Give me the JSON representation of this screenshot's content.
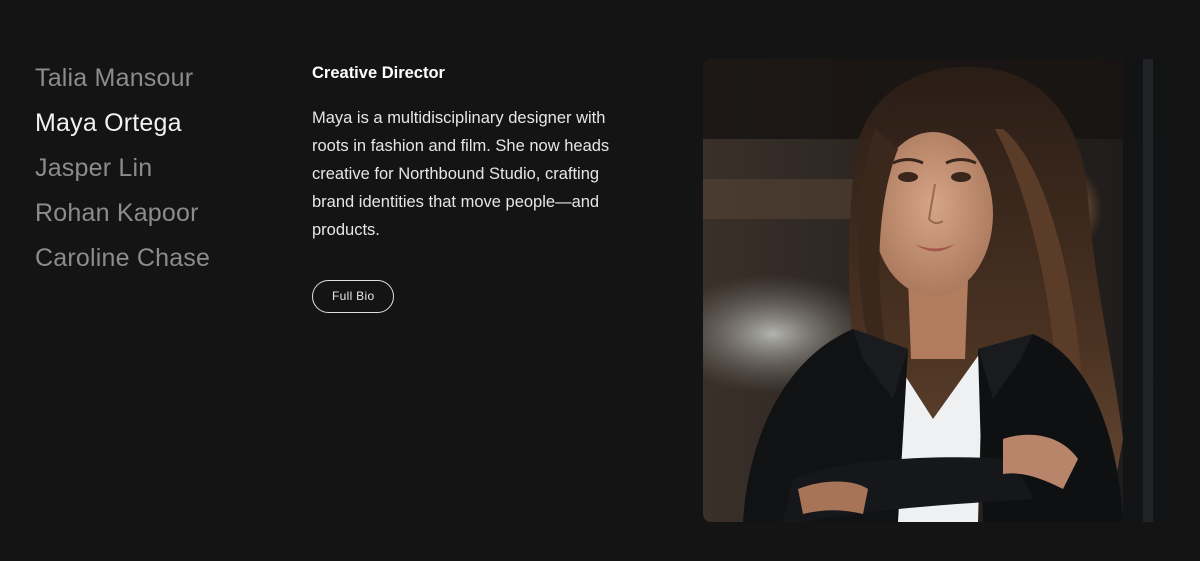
{
  "team": {
    "members": [
      {
        "name": "Talia Mansour"
      },
      {
        "name": "Maya Ortega"
      },
      {
        "name": "Jasper Lin"
      },
      {
        "name": "Rohan Kapoor"
      },
      {
        "name": "Caroline Chase"
      }
    ],
    "active_index": 1
  },
  "bio": {
    "role": "Creative Director",
    "text": "Maya is a multidisciplinary designer with roots in fashion and film. She now heads creative for Northbound Studio, crafting brand identities that move people—and products.",
    "button_label": "Full Bio"
  },
  "portrait": {
    "subject": "portrait-photo"
  }
}
